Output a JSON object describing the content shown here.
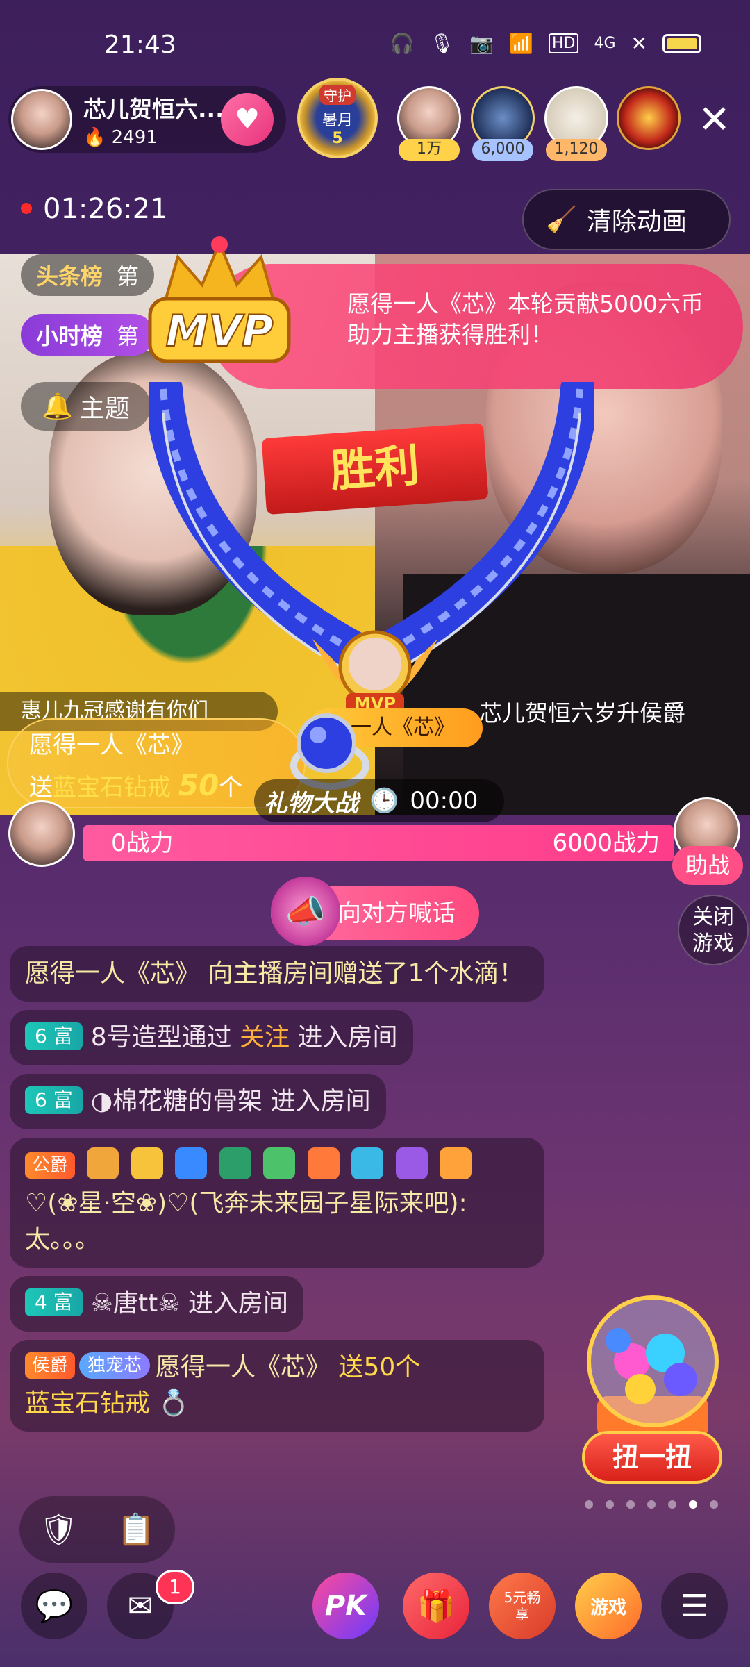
{
  "status_bar": {
    "time": "21:43",
    "network": "4G",
    "hd": "HD"
  },
  "host": {
    "name": "芯儿贺恒六...",
    "heat": "2491"
  },
  "guard_badge": {
    "label": "守护",
    "month_label": "暑月",
    "level": "5"
  },
  "viewers": [
    {
      "badge": "1万",
      "badge_color": "#ffd24a"
    },
    {
      "badge": "6,000",
      "badge_color": "#a6c2ff"
    },
    {
      "badge": "1,120",
      "badge_color": "#ffb86a"
    }
  ],
  "timer": "01:26:21",
  "clear_animation_label": "清除动画",
  "ranks": {
    "headline": "头条榜",
    "headline_suffix": "第",
    "hourly": "小时榜",
    "hourly_suffix": "第"
  },
  "topic_label": "主题",
  "mvp_banner": {
    "badge": "MVP",
    "text": "愿得一人《芯》本轮贡献5000六币助力主播获得胜利！"
  },
  "victory_label": "胜利",
  "mvp_medal": "MVP",
  "left_note": "惠儿九冠感谢有你们",
  "host_tag_right": "芯儿贺恒六岁升侯爵",
  "mvp_user_tag": "一人《芯》",
  "gift_notice": {
    "user": "愿得一人《芯》",
    "send": "送",
    "gift": "蓝宝石钻戒",
    "count": "50",
    "unit": "个"
  },
  "gift_war": {
    "label": "礼物大战",
    "time": "00:00"
  },
  "battle": {
    "left": "0战力",
    "right": "6000战力",
    "help": "助战"
  },
  "close_game": [
    "关闭",
    "游戏"
  ],
  "shout_label": "向对方喊话",
  "chat": [
    {
      "text": "愿得一人《芯》 向主播房间赠送了1个水滴！"
    },
    {
      "level": "6 富",
      "name": "8号造型通过",
      "follow": "关注",
      "action": "进入房间"
    },
    {
      "level": "6 富",
      "name": "◑棉花糖的骨架",
      "action": "进入房间"
    },
    {
      "title": "公爵",
      "message": "♡(❀星·空❀)♡(飞奔未来园子星际来吧): 太。。。"
    },
    {
      "level": "4 富",
      "name": "☠唐tt☠",
      "action": "进入房间"
    },
    {
      "title": "侯爵",
      "pet": "独宠芯",
      "user": "愿得一人《芯》",
      "send": "送50个",
      "gift": "蓝宝石钻戒"
    }
  ],
  "gacha_label": "扭一扭",
  "bottom": {
    "notif_count": "1",
    "promo": "5元畅享",
    "game": "游戏"
  },
  "colors": {
    "accent_pink": "#ff4a7e",
    "gold": "#ffd84a",
    "teal": "#1dc7b8"
  }
}
